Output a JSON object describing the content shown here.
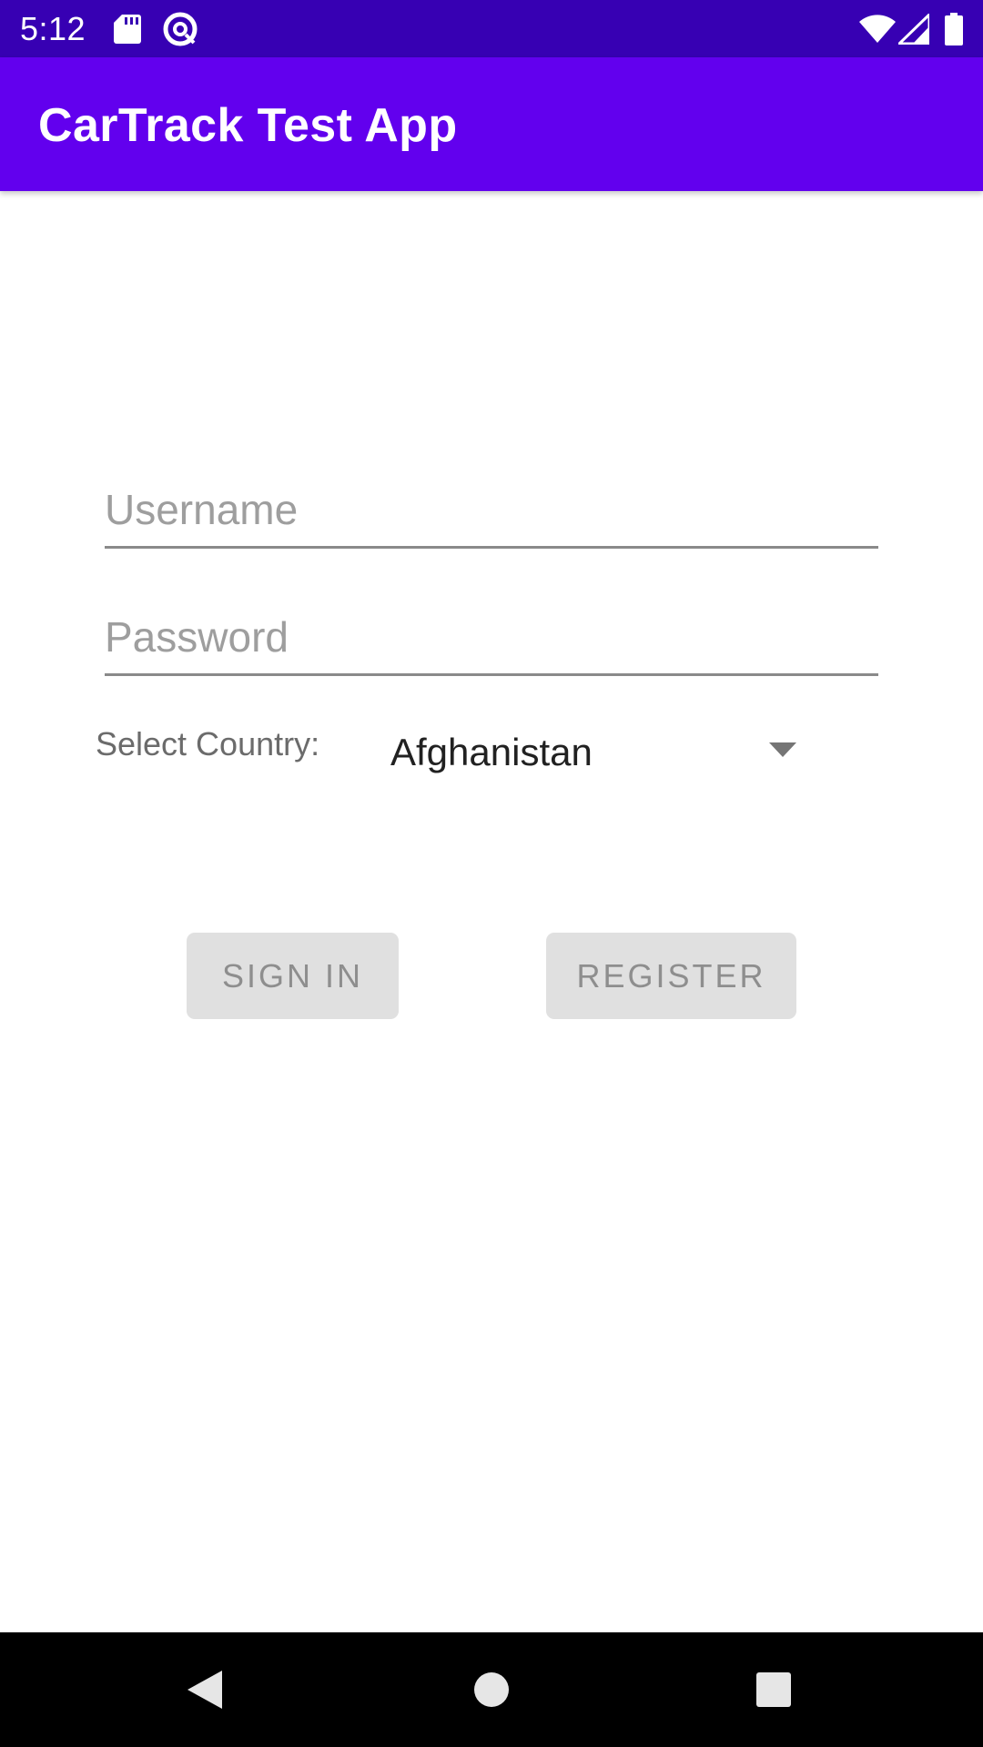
{
  "status_bar": {
    "time": "5:12",
    "icons": [
      "sd-card-icon",
      "at-sign-icon",
      "wifi-icon",
      "cell-signal-icon",
      "battery-icon"
    ]
  },
  "app_bar": {
    "title": "CarTrack Test App"
  },
  "form": {
    "username": {
      "placeholder": "Username",
      "value": ""
    },
    "password": {
      "placeholder": "Password",
      "value": ""
    },
    "country": {
      "label": "Select Country:",
      "selected": "Afghanistan"
    }
  },
  "buttons": {
    "sign_in": "SIGN IN",
    "register": "REGISTER"
  },
  "nav_bar": {
    "icons": [
      "back-icon",
      "home-icon",
      "recents-icon"
    ]
  },
  "colors": {
    "status_bar": "#3700b3",
    "app_bar": "#6200ee",
    "button_bg": "#e0e0e0",
    "button_text": "#8e8e8e",
    "nav_bar": "#000000"
  }
}
